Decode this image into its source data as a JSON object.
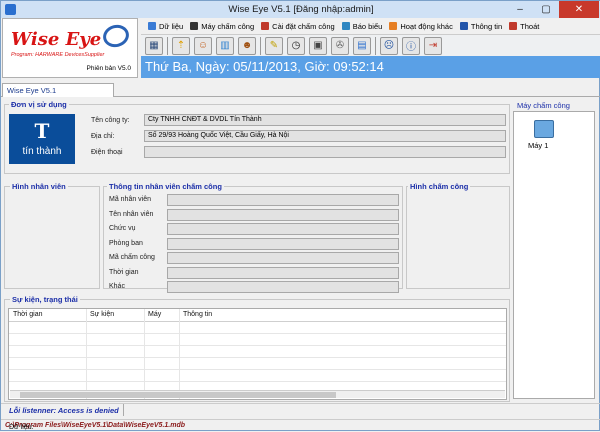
{
  "window": {
    "title": "Wise Eye V5.1 [Đăng nhập:admin]"
  },
  "logo": {
    "brand": "Wise Eye",
    "tagline": "Program: HARWARE DevicesSupplier",
    "version": "Phiên bản V5.0"
  },
  "menu": [
    {
      "label": "Dữ liệu",
      "color": "#3a7bd5"
    },
    {
      "label": "Máy chấm công",
      "color": "#333333"
    },
    {
      "label": "Cài đặt chấm công",
      "color": "#c0392b"
    },
    {
      "label": "Báo biểu",
      "color": "#2e86c1"
    },
    {
      "label": "Hoạt động khác",
      "color": "#e67e22"
    },
    {
      "label": "Thông tin",
      "color": "#2255aa"
    },
    {
      "label": "Thoát",
      "color": "#c0392b"
    }
  ],
  "toolbar": [
    {
      "icon": "terminal-icon",
      "glyph": "▦",
      "color": "#2b4a7a"
    },
    {
      "icon": "upload-icon",
      "glyph": "⇡",
      "color": "#e0a000"
    },
    {
      "icon": "users-icon",
      "glyph": "☺",
      "color": "#c06020"
    },
    {
      "icon": "chart-icon",
      "glyph": "▥",
      "color": "#2a7fd0"
    },
    {
      "icon": "group-icon",
      "glyph": "☻",
      "color": "#a05010"
    },
    {
      "icon": "notepad-icon",
      "glyph": "✎",
      "color": "#c0a000"
    },
    {
      "icon": "clock-icon",
      "glyph": "◷",
      "color": "#222222"
    },
    {
      "icon": "calendar-icon",
      "glyph": "▣",
      "color": "#444444"
    },
    {
      "icon": "wrench-icon",
      "glyph": "✇",
      "color": "#666666"
    },
    {
      "icon": "report-icon",
      "glyph": "▤",
      "color": "#2a6fcf"
    },
    {
      "icon": "user-settings-icon",
      "glyph": "☹",
      "color": "#1c4fa0"
    },
    {
      "icon": "info-icon",
      "glyph": "ⓘ",
      "color": "#1c4fa0"
    },
    {
      "icon": "exit-icon",
      "glyph": "⇥",
      "color": "#c0392b"
    }
  ],
  "datetime": "Thứ Ba, Ngày: 05/11/2013, Giờ: 09:52:14",
  "tab": "Wise Eye V5.1",
  "org": {
    "title": "Đơn vị sử dụng",
    "logo_text": "tín thành",
    "company_label": "Tên công ty:",
    "company": "Cty TNHH CNĐT & DVDL Tín Thành",
    "address_label": "Địa chỉ:",
    "address": "Số 29/93 Hoàng Quốc Việt, Cầu Giấy, Hà Nội",
    "phone_label": "Điện thoại",
    "phone": ""
  },
  "employee_photo_title": "Hình nhân viên",
  "employee_info": {
    "title": "Thông tin nhân viên chấm công",
    "fields": [
      {
        "label": "Mã nhân viên",
        "value": ""
      },
      {
        "label": "Tên nhân viên",
        "value": ""
      },
      {
        "label": "Chức vụ",
        "value": ""
      },
      {
        "label": "Phòng ban",
        "value": ""
      },
      {
        "label": "Mã chấm công",
        "value": ""
      },
      {
        "label": "Thời gian",
        "value": ""
      },
      {
        "label": "Khác",
        "value": ""
      }
    ]
  },
  "punch_photo_title": "Hình chấm công",
  "devices": {
    "title": "Máy chấm công",
    "items": [
      "Máy 1"
    ]
  },
  "events": {
    "title": "Sự kiện, trạng thái",
    "columns": [
      "Thời gian",
      "Sự kiện",
      "Máy",
      "Thông tin"
    ]
  },
  "status": {
    "error": "Lỗi listenner: Access is denied"
  },
  "path": {
    "label": "Dữ liệu:",
    "value": "C:\\Program Files\\WiseEyeV5.1\\Data\\WiseEyeV5.1.mdb"
  }
}
